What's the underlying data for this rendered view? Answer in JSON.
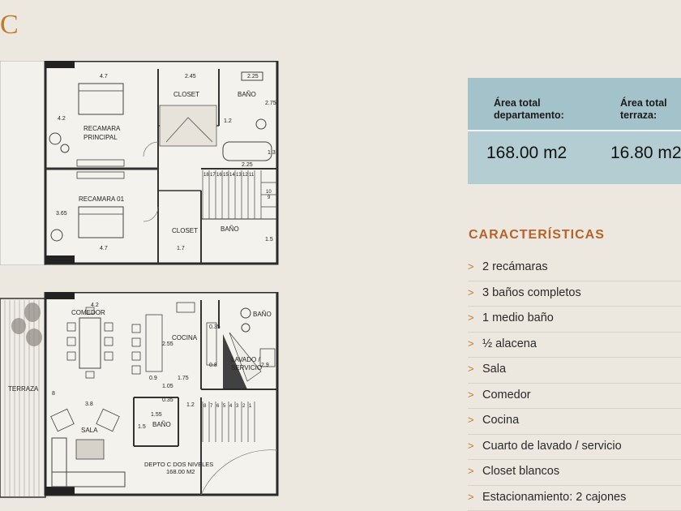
{
  "header": {
    "unit_letter": "C"
  },
  "plans": {
    "upper": {
      "dims": [
        "4.7",
        "2.45",
        "2.25",
        "4.2",
        "1.2",
        "2.75",
        "1.3",
        "2.25",
        "3.65",
        "1.7",
        "4.7",
        "1.5"
      ],
      "rooms": {
        "closet_1": "CLOSET",
        "bano_1": "BAÑO",
        "recamara_principal": "RECAMARA\nPRINCIPAL",
        "recamara_01": "RECAMARA 01",
        "closet_2": "CLOSET",
        "bano_2": "BAÑO"
      },
      "stairs": [
        "18",
        "17",
        "16",
        "15",
        "14",
        "13",
        "12",
        "11",
        "10",
        "9"
      ]
    },
    "lower": {
      "dims": [
        "4.2",
        "8",
        "3.8",
        "2.55",
        "0.9",
        "1.75",
        "1.05",
        "0.35",
        "1.2",
        "0.8",
        "2.9",
        "1.55",
        "1.5",
        "0.35"
      ],
      "rooms": {
        "comedor": "COMEDOR",
        "cocina": "COCINA",
        "lavado": "LAVADO /\nSERVICIO",
        "bano_lower_right": "BAÑO",
        "terraza": "TERRAZA",
        "sala": "SALA",
        "bano_lower": "BAÑO"
      },
      "footer_label_1": "DEPTO C DOS NIVELES",
      "footer_label_2": "168.00 M2",
      "stairs": [
        "8",
        "7",
        "6",
        "5",
        "4",
        "3",
        "2",
        "1"
      ]
    }
  },
  "area": {
    "dept_label": "Área total\ndepartamento:",
    "terrace_label": "Área total\nterraza:",
    "dept_value": "168.00 m2",
    "terrace_value": "16.80 m2"
  },
  "features_title": "CARACTERÍSTICAS",
  "bullet_glyph": ">",
  "features": [
    "2 recámaras",
    "3 baños completos",
    "1 medio baño",
    "½ alacena",
    "Sala",
    "Comedor",
    "Cocina",
    "Cuarto de lavado / servicio",
    "Closet blancos",
    "Estacionamiento: 2 cajones"
  ],
  "colors": {
    "background": "#ece8df",
    "accent": "#c07a2e",
    "title": "#b8622a",
    "table_head": "#a3c2ca",
    "table_body": "#b3cdd3"
  }
}
